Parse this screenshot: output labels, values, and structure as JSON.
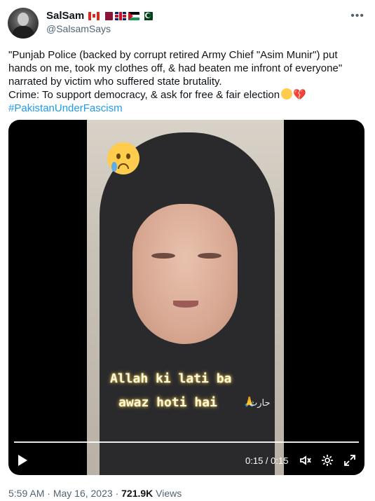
{
  "author": {
    "display_name": "SalSam",
    "handle": "@SalsamSays"
  },
  "tweet": {
    "lines": [
      "\"Punjab Police (backed by corrupt retired Army Chief \"Asim Munir\") put",
      "hands on me, took my clothes off, & had beaten me infront of everyone\"",
      "narrated by victim who suffered state brutality.",
      "Crime: To support democracy, & ask for free & fair election"
    ],
    "hashtag": "#PakistanUnderFascism"
  },
  "video": {
    "caption_line1": "Allah ki lati ba",
    "caption_line2": "awaz hoti hai",
    "watermark": "حارث",
    "time_display": "0:15 / 0:15"
  },
  "footer": {
    "time": "5:59 AM",
    "separator": "·",
    "date": "May 16, 2023",
    "views_count": "721.9K",
    "views_label": "Views"
  },
  "icons": [
    "more-icon",
    "play-icon",
    "volume-icon",
    "settings-icon",
    "fullscreen-icon"
  ],
  "colors": {
    "link": "#1d9bf0",
    "text": "#0f1419",
    "secondary": "#536471"
  }
}
